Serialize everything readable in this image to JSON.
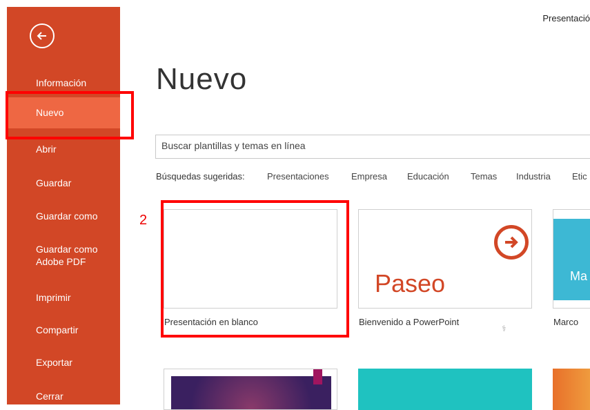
{
  "window": {
    "doc_title": "Presentació"
  },
  "sidebar": {
    "items": [
      {
        "label": "Información"
      },
      {
        "label": "Nuevo"
      },
      {
        "label": "Abrir"
      },
      {
        "label": "Guardar"
      },
      {
        "label": "Guardar como"
      },
      {
        "label": "Guardar como\nAdobe PDF"
      },
      {
        "label": "Imprimir"
      },
      {
        "label": "Compartir"
      },
      {
        "label": "Exportar"
      },
      {
        "label": "Cerrar"
      }
    ]
  },
  "main": {
    "title": "Nuevo",
    "search": {
      "placeholder": "Buscar plantillas y temas en línea"
    },
    "suggested_label": "Búsquedas sugeridas:",
    "suggested": [
      "Presentaciones",
      "Empresa",
      "Educación",
      "Temas",
      "Industria",
      "Etic"
    ],
    "annotation_number": "2",
    "templates": [
      {
        "label": "Presentación en blanco"
      },
      {
        "label": "Bienvenido a PowerPoint",
        "title_text": "Paseo"
      },
      {
        "label": "Marco",
        "title_text": "Ma"
      }
    ]
  },
  "colors": {
    "accent": "#d24726",
    "active": "#ee6743",
    "highlight": "#ff0000",
    "teal": "#1fc2c0",
    "blue": "#3db8d4"
  }
}
